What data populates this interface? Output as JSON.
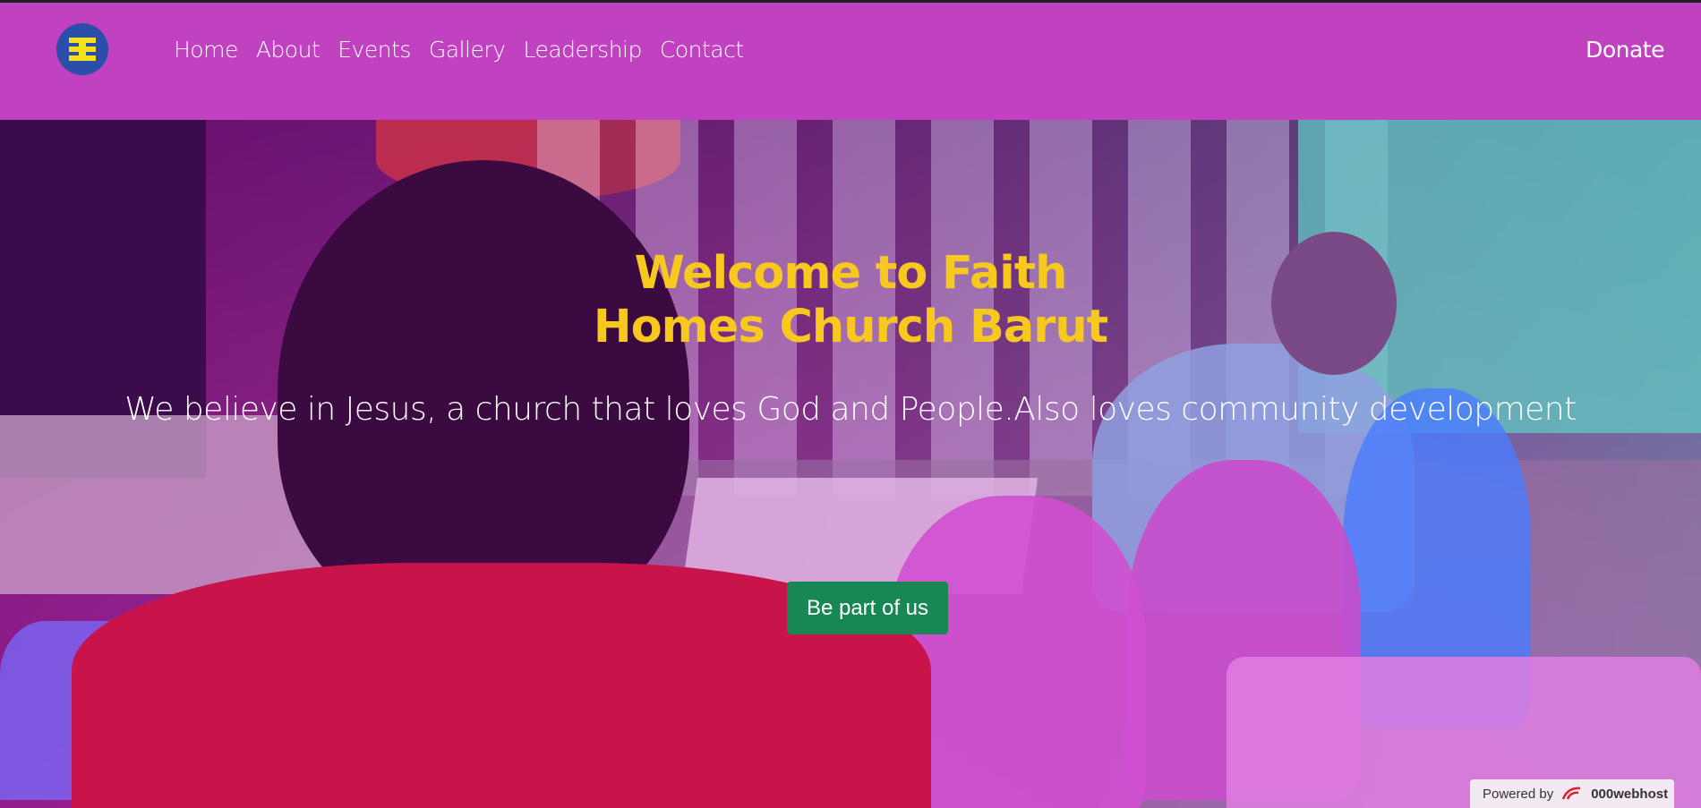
{
  "nav": {
    "logo_icon": "church-logo-icon",
    "links": [
      {
        "label": "Home"
      },
      {
        "label": "About"
      },
      {
        "label": "Events"
      },
      {
        "label": "Gallery"
      },
      {
        "label": "Leadership"
      },
      {
        "label": "Contact"
      }
    ],
    "donate_label": "Donate"
  },
  "hero": {
    "title_line1": "Welcome to Faith",
    "title_line2": "Homes Church Barut",
    "subtitle": "We believe in Jesus, a church that loves God and People.Also loves community development",
    "cta_label": "Be part of us"
  },
  "footer_badge": {
    "prefix": "Powered by",
    "brand": "000webhost",
    "icon": "webhost-logo-icon"
  },
  "colors": {
    "navbar": "#c042c0",
    "title": "#f7c81e",
    "cta": "#198754"
  }
}
